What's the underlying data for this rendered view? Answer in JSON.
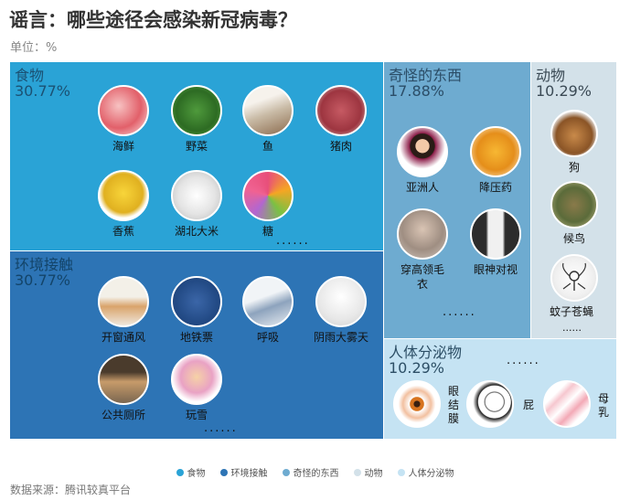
{
  "title": "谣言：哪些途径会感染新冠病毒？",
  "unit": "单位：%",
  "source": "数据来源：腾讯较真平台",
  "chart_data": {
    "type": "treemap",
    "title": "谣言：哪些途径会感染新冠病毒？",
    "series": [
      {
        "name": "食物",
        "value": 30.77,
        "label": "30.77%",
        "color": "#2aa3d6",
        "items": [
          "海鲜",
          "野菜",
          "鱼",
          "猪肉",
          "香蕉",
          "湖北大米",
          "糖"
        ],
        "more": "......"
      },
      {
        "name": "环境接触",
        "value": 30.77,
        "label": "30.77%",
        "color": "#2d74b5",
        "items": [
          "开窗通风",
          "地铁票",
          "呼吸",
          "阴雨大雾天",
          "公共厕所",
          "玩雪"
        ],
        "more": "......"
      },
      {
        "name": "奇怪的东西",
        "value": 17.88,
        "label": "17.88%",
        "color": "#6eabd0",
        "items": [
          "亚洲人",
          "降压药",
          "穿高领毛衣",
          "眼神对视"
        ],
        "more": "......"
      },
      {
        "name": "动物",
        "value": 10.29,
        "label": "10.29%",
        "color": "#d3e1e9",
        "items": [
          "狗",
          "候鸟",
          "蚊子苍蝇"
        ],
        "more": "......"
      },
      {
        "name": "人体分泌物",
        "value": 10.29,
        "label": "10.29%",
        "color": "#c5e3f3",
        "items": [
          "眼结膜",
          "屁",
          "母乳"
        ],
        "more": "......"
      }
    ],
    "legend": {
      "position": "bottom",
      "entries": [
        "食物",
        "环境接触",
        "奇怪的东西",
        "动物",
        "人体分泌物"
      ]
    }
  }
}
